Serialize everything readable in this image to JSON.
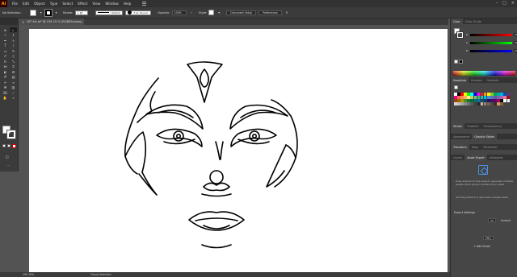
{
  "app": {
    "logo": "Ai",
    "menus": [
      "File",
      "Edit",
      "Object",
      "Type",
      "Select",
      "Effect",
      "View",
      "Window",
      "Help"
    ]
  },
  "control": {
    "selection_label": "No Selection",
    "stroke_label": "Stroke:",
    "stroke_weight": "1 pt",
    "uniform_label": "Uniform",
    "brush_label": "3 pt. Round",
    "opacity_label": "Opacity:",
    "opacity_value": "100%",
    "style_label": "Style:",
    "doc_setup": "Document Setup",
    "preferences": "Preferences"
  },
  "document": {
    "tab_title": "WT Art.ai* @ 195.15 % (RGB/Preview)",
    "close_glyph": "×"
  },
  "status": {
    "zoom": "195.15%",
    "tool": "Group Selection"
  },
  "panels": {
    "color_tabs": [
      "Color",
      "Color Guide"
    ],
    "color_sliders": [
      {
        "label": "R",
        "value": "255"
      },
      {
        "label": "G",
        "value": "255"
      },
      {
        "label": "B",
        "value": "255"
      }
    ],
    "swatch_tabs": [
      "Swatches",
      "Brushes",
      "Symbols"
    ],
    "stroke_tabs": [
      "Stroke",
      "Gradient",
      "Transparency"
    ],
    "appearance_tabs": [
      "Appearance",
      "Graphic Styles"
    ],
    "transform_tabs": [
      "Transform",
      "Align",
      "Pathfinder"
    ],
    "asset_tabs": [
      "Layers",
      "Asset Export",
      "Artboards"
    ],
    "asset_hint1": "Drag artwork to this panel to generate multiple assets. Each group is added as an asset.",
    "asset_hint2": "Alt-drag artwork to generate a single asset.",
    "export_settings": "Export Settings",
    "export_scale": "1x",
    "export_suffix": "Android",
    "export_format": "PNG",
    "add_scale": "+ Add Scale"
  },
  "colors": {
    "swatches": [
      "#ffffff",
      "#000000",
      "#ff0000",
      "#ffff00",
      "#00ff00",
      "#00ffff",
      "#0000ff",
      "#ff00ff",
      "#ed1c24",
      "#f7941d",
      "#fff200",
      "#8dc63f",
      "#00a651",
      "#00a99d",
      "#00aeef",
      "#0054a6",
      "#662d91",
      "#ec008c",
      "#f26c4f",
      "#f68e56",
      "#fbaf5d",
      "#fff568",
      "#acd373",
      "#7cc576",
      "#3cb878",
      "#1cbbb4",
      "#00bff3",
      "#448ccb",
      "#5674b9",
      "#605ca8",
      "#855fa8",
      "#a864a8",
      "#f06ea9",
      "#9e0b0f",
      "#a0410d",
      "#a36209",
      "#aba000",
      "#598527",
      "#1a7b30",
      "#007236",
      "#00746b",
      "#0076a3",
      "#004a80",
      "#003471",
      "#1b1464",
      "#440e62",
      "#630460",
      "#9e005d",
      "#000000",
      "#ffffff",
      "#f2f2f2",
      "#d9d9d9",
      "#bfbfbf",
      "#a6a6a6",
      "#8c8c8c",
      "#737373",
      "#595959",
      "#404040",
      "#262626",
      "#c7b299",
      "#998675",
      "#736357",
      "#534741",
      "#362f2d",
      "#c69c6d",
      "#8c6239"
    ]
  }
}
